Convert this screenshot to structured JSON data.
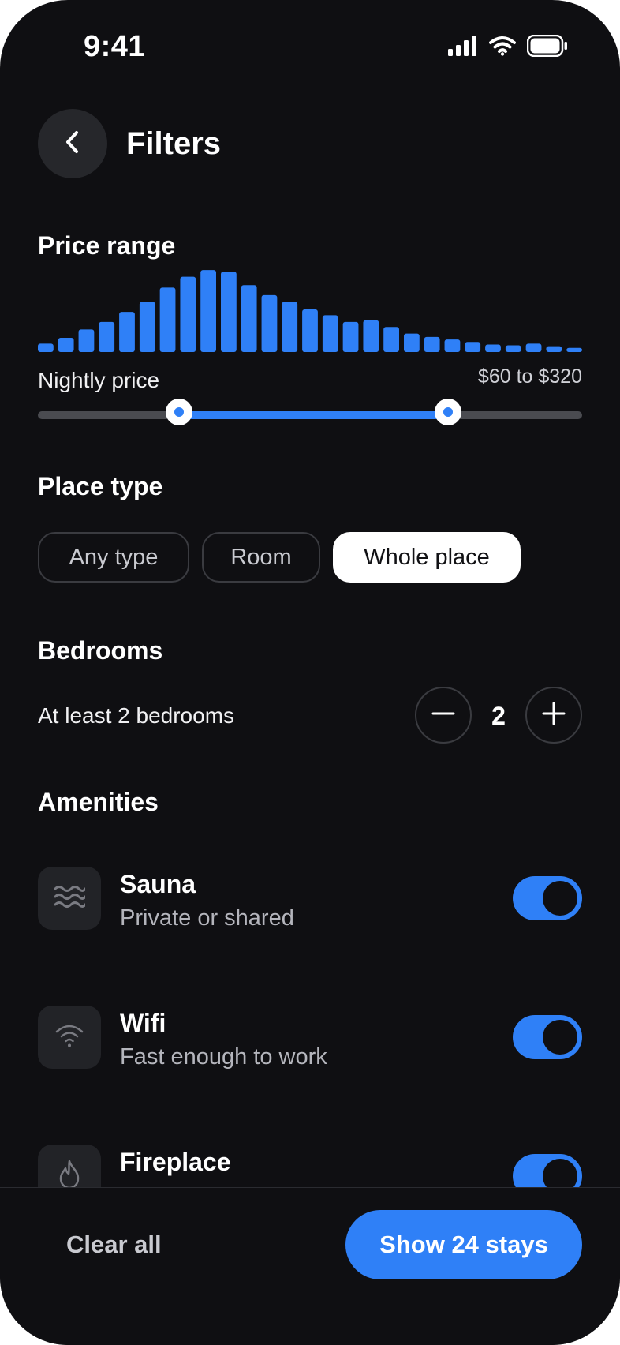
{
  "status_bar": {
    "time": "9:41",
    "icons": [
      "signal-icon",
      "wifi-icon",
      "battery-icon"
    ]
  },
  "header": {
    "title": "Filters",
    "back_icon": "chevron-left-icon"
  },
  "price_range": {
    "title": "Price range",
    "label": "Nightly price",
    "value_text": "$60 to $320",
    "histogram_levels": [
      0.1,
      0.17,
      0.27,
      0.36,
      0.48,
      0.6,
      0.77,
      0.9,
      0.98,
      0.96,
      0.8,
      0.68,
      0.6,
      0.51,
      0.44,
      0.36,
      0.38,
      0.3,
      0.22,
      0.18,
      0.15,
      0.12,
      0.09,
      0.08,
      0.1,
      0.07,
      0.05
    ],
    "range_selected": [
      0.26,
      0.753
    ],
    "accent_color": "#2f80f7"
  },
  "place_type": {
    "title": "Place type",
    "options": [
      "Any type",
      "Room",
      "Whole place"
    ],
    "selected": "Whole place"
  },
  "bedrooms": {
    "title": "Bedrooms",
    "label": "At least 2 bedrooms",
    "value": "2",
    "minus_icon": "minus-icon",
    "plus_icon": "plus-icon"
  },
  "amenities": {
    "title": "Amenities",
    "items": [
      {
        "name": "Sauna",
        "description": "Private or shared",
        "icon": "waves-icon",
        "enabled": true
      },
      {
        "name": "Wifi",
        "description": "Fast enough to work",
        "icon": "wifi-icon",
        "enabled": true
      },
      {
        "name": "Fireplace",
        "description": "",
        "icon": "flame-icon",
        "enabled": true
      }
    ]
  },
  "footer": {
    "clear_label": "Clear all",
    "show_label": "Show 24 stays"
  }
}
